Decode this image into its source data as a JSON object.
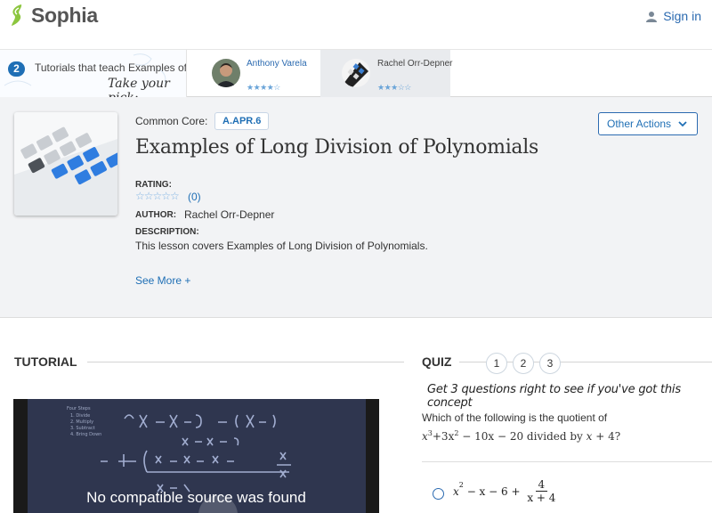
{
  "header": {
    "brand": "Sophia",
    "sign_in": "Sign in"
  },
  "tutorial_picker": {
    "count": "2",
    "text": "Tutorials that teach Examples of Long Division of Polynomials",
    "pick": "Take your pick:",
    "tutors": [
      {
        "name": "Anthony Varela",
        "stars": "★★★★☆"
      },
      {
        "name": "Rachel Orr-Depner",
        "stars": "★★★☆☆"
      }
    ]
  },
  "lesson": {
    "common_core_label": "Common Core:",
    "common_core_code": "A.APR.6",
    "title": "Examples of Long Division of Polynomials",
    "rating_label": "RATING:",
    "rating_stars": "☆☆☆☆☆",
    "rating_count": "(0)",
    "author_label": "AUTHOR:",
    "author": "Rachel Orr-Depner",
    "description_label": "DESCRIPTION:",
    "description": "This lesson covers Examples of Long Division of Polynomials.",
    "see_more": "See More +",
    "other_actions": "Other Actions"
  },
  "tutorial_section": {
    "label": "TUTORIAL",
    "video_message": "No compatible source was found"
  },
  "quiz": {
    "label": "QUIZ",
    "steps": [
      "1",
      "2",
      "3"
    ],
    "hint": "Get 3 questions right to see if you've got this concept",
    "question_line1": "Which of the following is the quotient of",
    "question_line2_parts": [
      "x",
      "3",
      "+3x",
      "2",
      " − 10x − 20 divided by ",
      "x",
      " + 4?"
    ],
    "answer": {
      "lead": "x",
      "sup": "2",
      "rest": " − x − 6 + ",
      "num": "4",
      "den": "x + 4"
    }
  },
  "colors": {
    "accent": "#1f6fb5",
    "logo_green": "#8cc63f"
  }
}
